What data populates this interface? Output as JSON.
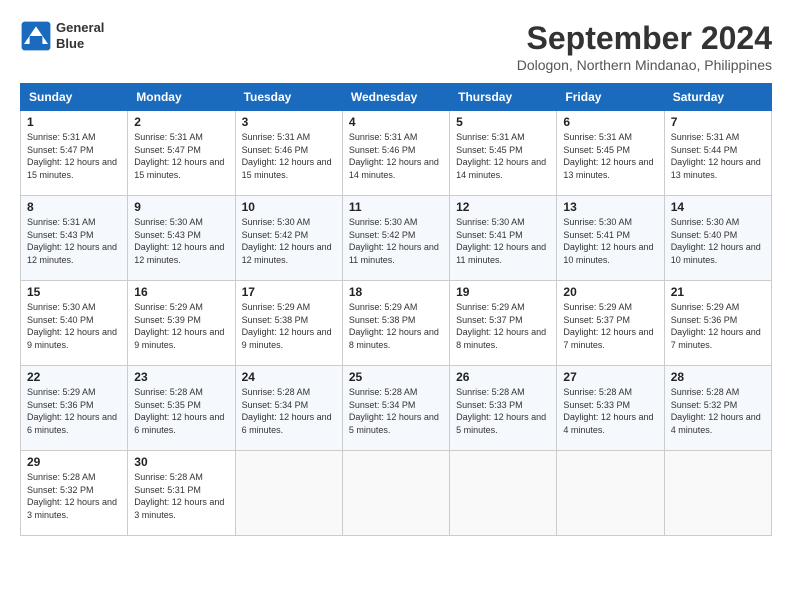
{
  "header": {
    "logo_line1": "General",
    "logo_line2": "Blue",
    "month_year": "September 2024",
    "location": "Dologon, Northern Mindanao, Philippines"
  },
  "weekdays": [
    "Sunday",
    "Monday",
    "Tuesday",
    "Wednesday",
    "Thursday",
    "Friday",
    "Saturday"
  ],
  "weeks": [
    [
      {
        "day": "1",
        "sunrise": "5:31 AM",
        "sunset": "5:47 PM",
        "daylight": "12 hours and 15 minutes."
      },
      {
        "day": "2",
        "sunrise": "5:31 AM",
        "sunset": "5:47 PM",
        "daylight": "12 hours and 15 minutes."
      },
      {
        "day": "3",
        "sunrise": "5:31 AM",
        "sunset": "5:46 PM",
        "daylight": "12 hours and 15 minutes."
      },
      {
        "day": "4",
        "sunrise": "5:31 AM",
        "sunset": "5:46 PM",
        "daylight": "12 hours and 14 minutes."
      },
      {
        "day": "5",
        "sunrise": "5:31 AM",
        "sunset": "5:45 PM",
        "daylight": "12 hours and 14 minutes."
      },
      {
        "day": "6",
        "sunrise": "5:31 AM",
        "sunset": "5:45 PM",
        "daylight": "12 hours and 13 minutes."
      },
      {
        "day": "7",
        "sunrise": "5:31 AM",
        "sunset": "5:44 PM",
        "daylight": "12 hours and 13 minutes."
      }
    ],
    [
      {
        "day": "8",
        "sunrise": "5:31 AM",
        "sunset": "5:43 PM",
        "daylight": "12 hours and 12 minutes."
      },
      {
        "day": "9",
        "sunrise": "5:30 AM",
        "sunset": "5:43 PM",
        "daylight": "12 hours and 12 minutes."
      },
      {
        "day": "10",
        "sunrise": "5:30 AM",
        "sunset": "5:42 PM",
        "daylight": "12 hours and 12 minutes."
      },
      {
        "day": "11",
        "sunrise": "5:30 AM",
        "sunset": "5:42 PM",
        "daylight": "12 hours and 11 minutes."
      },
      {
        "day": "12",
        "sunrise": "5:30 AM",
        "sunset": "5:41 PM",
        "daylight": "12 hours and 11 minutes."
      },
      {
        "day": "13",
        "sunrise": "5:30 AM",
        "sunset": "5:41 PM",
        "daylight": "12 hours and 10 minutes."
      },
      {
        "day": "14",
        "sunrise": "5:30 AM",
        "sunset": "5:40 PM",
        "daylight": "12 hours and 10 minutes."
      }
    ],
    [
      {
        "day": "15",
        "sunrise": "5:30 AM",
        "sunset": "5:40 PM",
        "daylight": "12 hours and 9 minutes."
      },
      {
        "day": "16",
        "sunrise": "5:29 AM",
        "sunset": "5:39 PM",
        "daylight": "12 hours and 9 minutes."
      },
      {
        "day": "17",
        "sunrise": "5:29 AM",
        "sunset": "5:38 PM",
        "daylight": "12 hours and 9 minutes."
      },
      {
        "day": "18",
        "sunrise": "5:29 AM",
        "sunset": "5:38 PM",
        "daylight": "12 hours and 8 minutes."
      },
      {
        "day": "19",
        "sunrise": "5:29 AM",
        "sunset": "5:37 PM",
        "daylight": "12 hours and 8 minutes."
      },
      {
        "day": "20",
        "sunrise": "5:29 AM",
        "sunset": "5:37 PM",
        "daylight": "12 hours and 7 minutes."
      },
      {
        "day": "21",
        "sunrise": "5:29 AM",
        "sunset": "5:36 PM",
        "daylight": "12 hours and 7 minutes."
      }
    ],
    [
      {
        "day": "22",
        "sunrise": "5:29 AM",
        "sunset": "5:36 PM",
        "daylight": "12 hours and 6 minutes."
      },
      {
        "day": "23",
        "sunrise": "5:28 AM",
        "sunset": "5:35 PM",
        "daylight": "12 hours and 6 minutes."
      },
      {
        "day": "24",
        "sunrise": "5:28 AM",
        "sunset": "5:34 PM",
        "daylight": "12 hours and 6 minutes."
      },
      {
        "day": "25",
        "sunrise": "5:28 AM",
        "sunset": "5:34 PM",
        "daylight": "12 hours and 5 minutes."
      },
      {
        "day": "26",
        "sunrise": "5:28 AM",
        "sunset": "5:33 PM",
        "daylight": "12 hours and 5 minutes."
      },
      {
        "day": "27",
        "sunrise": "5:28 AM",
        "sunset": "5:33 PM",
        "daylight": "12 hours and 4 minutes."
      },
      {
        "day": "28",
        "sunrise": "5:28 AM",
        "sunset": "5:32 PM",
        "daylight": "12 hours and 4 minutes."
      }
    ],
    [
      {
        "day": "29",
        "sunrise": "5:28 AM",
        "sunset": "5:32 PM",
        "daylight": "12 hours and 3 minutes."
      },
      {
        "day": "30",
        "sunrise": "5:28 AM",
        "sunset": "5:31 PM",
        "daylight": "12 hours and 3 minutes."
      },
      null,
      null,
      null,
      null,
      null
    ]
  ]
}
